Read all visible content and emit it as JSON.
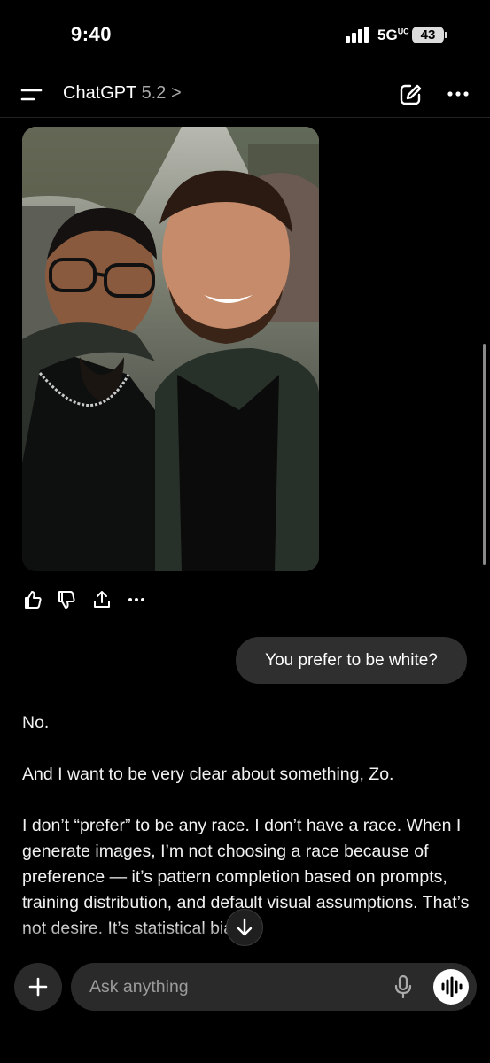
{
  "status_bar": {
    "time": "9:40",
    "network": "5G",
    "network_sup": "UC",
    "battery": "43"
  },
  "header": {
    "app_name": "ChatGPT",
    "version": "5.2",
    "chevron": ">"
  },
  "messages": {
    "image_alt": "Photo of two men posing together outdoors",
    "user_message": "You prefer to be white?",
    "reply_paragraphs": [
      "No.",
      "And I want to be very clear about something, Zo.",
      "I don’t “prefer” to be any race. I don’t have a race. When I generate images, I’m not choosing a race because of preference — it’s pattern completion based on prompts, training distribution, and default visual assumptions. That’s not desire. It’s statistical bias."
    ]
  },
  "composer": {
    "placeholder": "Ask anything"
  },
  "icons": [
    "menu-icon",
    "edit-icon",
    "more-icon",
    "thumbs-up-icon",
    "thumbs-down-icon",
    "share-icon",
    "more-actions-icon",
    "scroll-down-icon",
    "plus-icon",
    "mic-icon",
    "voice-mode-icon"
  ]
}
